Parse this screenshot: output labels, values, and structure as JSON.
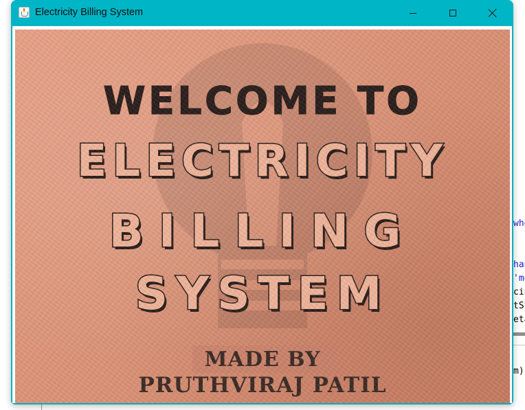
{
  "window": {
    "title": "Electricity Billing System"
  },
  "titlebar_controls": {
    "minimize": "minimize",
    "maximize": "maximize",
    "close": "close"
  },
  "splash": {
    "line1": "WELCOME TO",
    "line2": "ELECTRICITY",
    "line3": "BILLING",
    "line4": "SYSTEM",
    "made_by": "MADE BY",
    "author": "PRUTHVIRAJ PATIL"
  },
  "background_code": {
    "lines": [
      {
        "text": "whe",
        "color": "blue"
      },
      {
        "text": "han",
        "color": "blue"
      },
      {
        "text": "'mo",
        "color": "blue"
      },
      {
        "text": "cin",
        "color": "black"
      },
      {
        "text": "tSt",
        "color": "black"
      },
      {
        "text": "eta",
        "color": "black"
      },
      {
        "text": "m)",
        "color": "black"
      }
    ]
  },
  "colors": {
    "titlebar": "#00b5c6",
    "splash_base": "#e09a7e",
    "ink": "#2a1f1c"
  }
}
